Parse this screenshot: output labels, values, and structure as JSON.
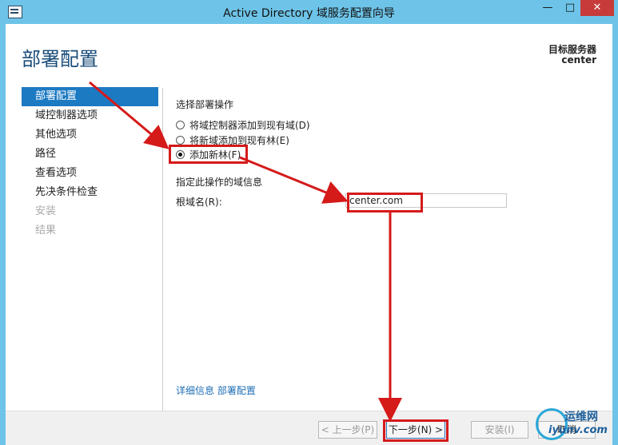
{
  "window": {
    "title": "Active Directory 域服务配置向导",
    "minimize": "—",
    "maximize": "□",
    "close": "✕"
  },
  "header": {
    "title": "部署配置",
    "target_label": "目标服务器",
    "target_name": "center"
  },
  "nav": {
    "items": [
      {
        "label": "部署配置",
        "state": "active"
      },
      {
        "label": "域控制器选项",
        "state": "normal"
      },
      {
        "label": "其他选项",
        "state": "normal"
      },
      {
        "label": "路径",
        "state": "normal"
      },
      {
        "label": "查看选项",
        "state": "normal"
      },
      {
        "label": "先决条件检查",
        "state": "normal"
      },
      {
        "label": "安装",
        "state": "disabled"
      },
      {
        "label": "结果",
        "state": "disabled"
      }
    ]
  },
  "content": {
    "section_label": "选择部署操作",
    "radios": [
      {
        "label": "将域控制器添加到现有域(D)",
        "checked": false
      },
      {
        "label": "将新域添加到现有林(E)",
        "checked": false
      },
      {
        "label": "添加新林(F)",
        "checked": true
      }
    ],
    "domain_info_label": "指定此操作的域信息",
    "root_domain_label": "根域名(R):",
    "root_domain_value": "center.com",
    "more_info_link": "详细信息 部署配置"
  },
  "footer": {
    "prev": "< 上一步(P)",
    "next": "下一步(N) >",
    "install": "安装(I)",
    "cancel": "取消"
  },
  "watermark": {
    "text": "运维网",
    "sub": "iyunv.com"
  },
  "annotation_color": "#d51a1a",
  "accent_color": "#1c7ac3"
}
